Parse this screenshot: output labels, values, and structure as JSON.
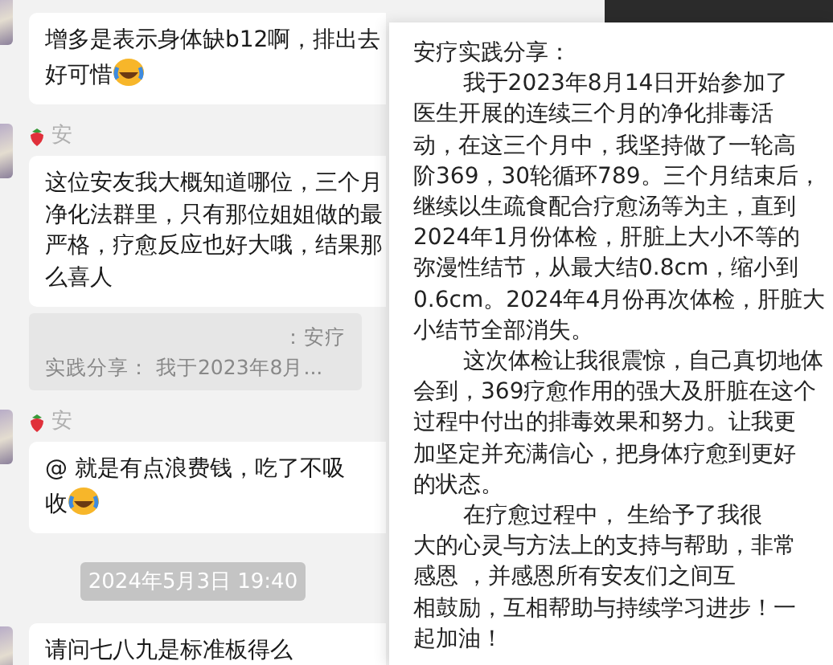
{
  "chat": [
    {
      "kind": "message",
      "lines": [
        "增多是表示身体缺b12啊，排出去",
        "好可惜"
      ],
      "emoji": true
    },
    {
      "kind": "message",
      "sender": "安",
      "lines": [
        "这位安友我大概知道哪位，三个月",
        "净化法群里，只有那位姐姐做的最",
        "严格，疗愈反应也好大哦，结果那",
        "么喜人"
      ],
      "quote": [
        "：安疗",
        "实践分享：     我于2023年8月..."
      ]
    },
    {
      "kind": "message",
      "sender": "安",
      "lines": [
        "@     就是有点浪费钱，吃了不吸",
        "收"
      ],
      "emoji": true
    },
    {
      "kind": "time",
      "text": "2024年5月3日 19:40"
    },
    {
      "kind": "message",
      "lines": [
        "请问七八九是标准板得么"
      ]
    }
  ],
  "popup": {
    "title": "安疗实践分享：",
    "paragraphs": [
      [
        "我于2023年8月14日开始参加了",
        "医生开展的连续三个月的净化排毒活",
        "动，在这三个月中，我坚持做了一轮高",
        "阶369，30轮循环789。三个月结束后，",
        "继续以生疏食配合疗愈汤等为主，直到",
        "2024年1月份体检，肝脏上大小不等的",
        "弥漫性结节，从最大结0.8cm，缩小到",
        "0.6cm。2024年4月份再次体检，肝脏大",
        "小结节全部消失。"
      ],
      [
        "这次体检让我很震惊，自己真切地体",
        "会到，369疗愈作用的强大及肝脏在这个",
        "过程中付出的排毒效果和努力。让我更",
        "加坚定并充满信心，把身体疗愈到更好",
        "的状态。"
      ],
      [
        "在疗愈过程中，    生给予了我很",
        "大的心灵与方法上的支持与帮助，非常",
        "感恩      ，并感恩所有安友们之间互",
        "相鼓励，互相帮助与持续学习进步！一",
        "起加油！"
      ]
    ]
  }
}
